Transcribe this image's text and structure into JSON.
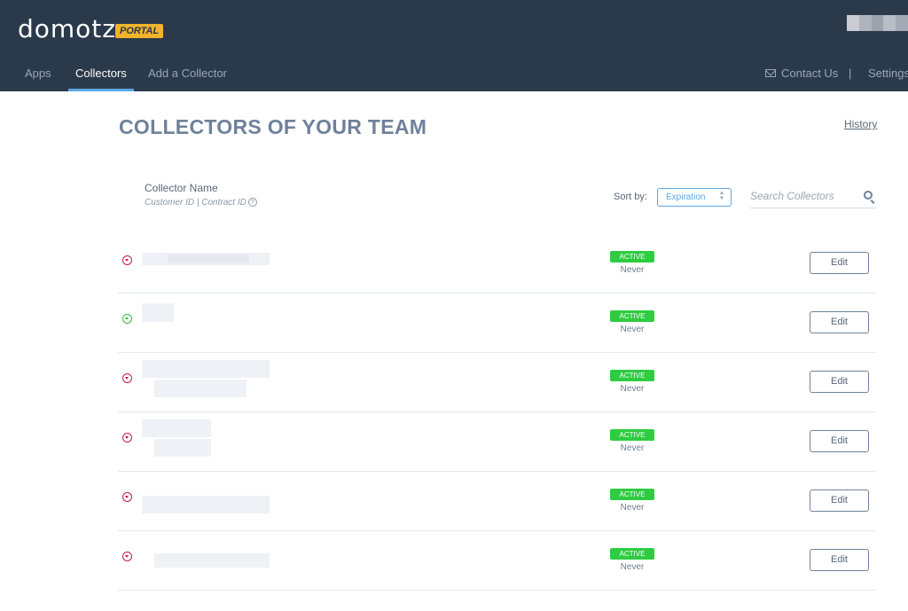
{
  "header": {
    "logo": "domotz",
    "badge": "PORTAL",
    "nav": [
      {
        "label": "Apps"
      },
      {
        "label": "Collectors"
      },
      {
        "label": "Add a Collector"
      }
    ],
    "contact": "Contact Us",
    "separator": "|",
    "settings": "Settings"
  },
  "main": {
    "title": "COLLECTORS OF YOUR TEAM",
    "history": "History",
    "column": {
      "title": "Collector Name",
      "subtitle": "Customer ID | Contract ID",
      "info": "?"
    },
    "sort": {
      "label": "Sort by:",
      "value": "Expiration",
      "arrows": "▲▼"
    },
    "search": {
      "placeholder": "Search Collectors"
    }
  },
  "collectors": [
    {
      "status": "ACTIVE",
      "expiry": "Never",
      "action": "Edit",
      "expanded": false
    },
    {
      "status": "ACTIVE",
      "expiry": "Never",
      "action": "Edit",
      "expanded": true
    },
    {
      "status": "ACTIVE",
      "expiry": "Never",
      "action": "Edit",
      "expanded": false
    },
    {
      "status": "ACTIVE",
      "expiry": "Never",
      "action": "Edit",
      "expanded": false
    },
    {
      "status": "ACTIVE",
      "expiry": "Never",
      "action": "Edit",
      "expanded": false
    },
    {
      "status": "ACTIVE",
      "expiry": "Never",
      "action": "Edit",
      "expanded": false
    }
  ],
  "colors": {
    "header_bg": "#2b3a4b",
    "badge_bg": "#f0b429",
    "active_green": "#2ecc40",
    "nav_underline": "#5aa7e5",
    "title": "#6f819a"
  }
}
